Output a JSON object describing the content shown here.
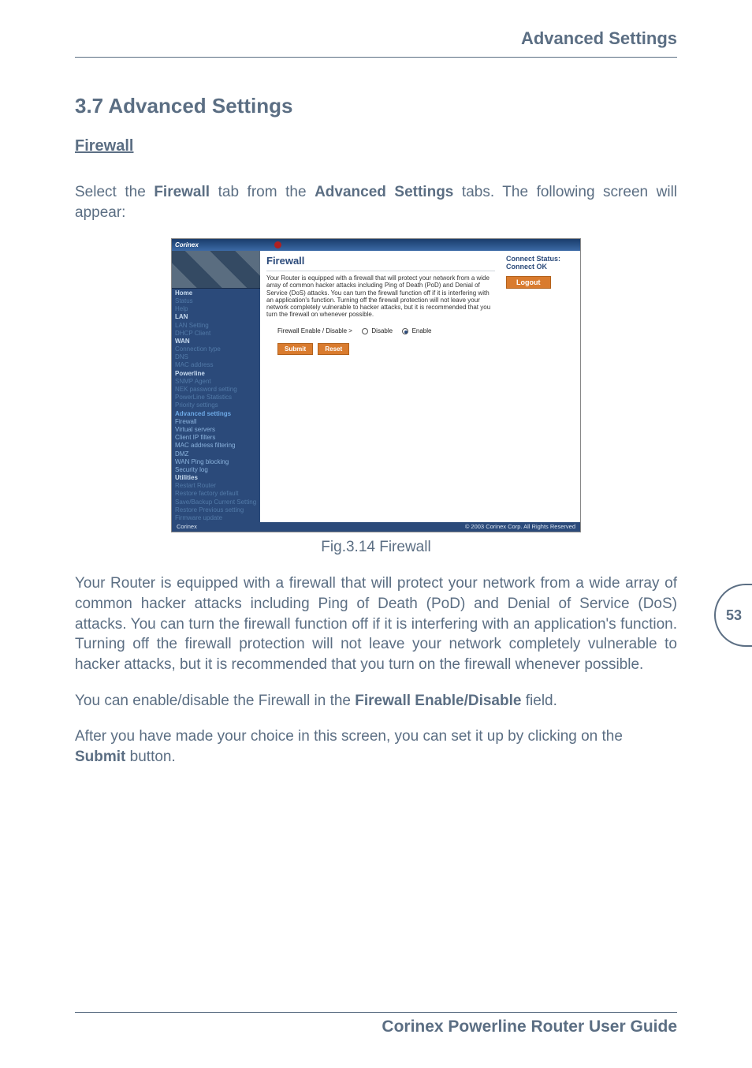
{
  "running_header": "Advanced Settings",
  "page_number": "53",
  "footer": "Corinex Powerline Router User Guide",
  "section_heading": "3.7 Advanced Settings",
  "sub_heading": "Firewall",
  "intro_para": {
    "pre": "Select the ",
    "b1": "Firewall",
    "mid": " tab from the ",
    "b2": "Advanced Settings",
    "post": " tabs. The following screen will appear:"
  },
  "figure_caption": "Fig.3.14 Firewall",
  "body_para_1": "Your Router is equipped with a firewall that will protect your network from a wide array of common hacker attacks including Ping of Death (PoD) and Denial of Service (DoS) attacks. You can turn the firewall function off if it is interfering with an application's function. Turning off the firewall protection will not leave your network completely vulnerable to hacker attacks, but it is recommended that you turn on the firewall whenever possible.",
  "body_para_2": {
    "pre": "You can enable/disable the Firewall in the ",
    "b1": "Firewall Enable/Disable",
    "post": " field."
  },
  "body_para_3": {
    "pre": "After you have made your choice in this screen, you can set it up by clicking on the ",
    "b1": "Submit",
    "post": " button."
  },
  "screenshot": {
    "brand": "Corinex",
    "panel_title": "Firewall",
    "description": "Your Router is equipped with a firewall that will protect your network from a wide array of common hacker attacks including Ping of Death (PoD) and Denial of Service (DoS) attacks. You can turn the firewall function off if it is interfering with an application's function. Turning off the firewall protection will not leave your network completely vulnerable to hacker attacks, but it is recommended that you turn the firewall on whenever possible.",
    "toggle_label": "Firewall Enable / Disable >",
    "radio_disable": "Disable",
    "radio_enable": "Enable",
    "btn_submit": "Submit",
    "btn_reset": "Reset",
    "status_label": "Connect Status:",
    "status_value": "Connect OK",
    "logout": "Logout",
    "footer_left": "Corinex",
    "footer_right": "© 2003 Corinex Corp. All Rights Reserved",
    "nav": [
      {
        "label": "Home",
        "cls": "top"
      },
      {
        "label": "Status",
        "cls": "dim"
      },
      {
        "label": "Help",
        "cls": "dim"
      },
      {
        "label": "LAN",
        "cls": "top"
      },
      {
        "label": "LAN Setting",
        "cls": "dim"
      },
      {
        "label": "DHCP Client",
        "cls": "dim"
      },
      {
        "label": "WAN",
        "cls": "top"
      },
      {
        "label": "Connection type",
        "cls": "dim"
      },
      {
        "label": "DNS",
        "cls": "dim"
      },
      {
        "label": "MAC address",
        "cls": "dim"
      },
      {
        "label": "Powerline",
        "cls": "top"
      },
      {
        "label": "SNMP Agent",
        "cls": "dim"
      },
      {
        "label": "NEK password setting",
        "cls": "dim"
      },
      {
        "label": "PowerLine Statistics",
        "cls": "dim"
      },
      {
        "label": "Priority settings",
        "cls": "dim"
      },
      {
        "label": "Advanced settings",
        "cls": "sel"
      },
      {
        "label": "Firewall",
        "cls": "mid"
      },
      {
        "label": "Virtual servers",
        "cls": "mid"
      },
      {
        "label": "Client IP filters",
        "cls": "mid"
      },
      {
        "label": "MAC address filtering",
        "cls": "mid"
      },
      {
        "label": "DMZ",
        "cls": "mid"
      },
      {
        "label": "WAN Ping blocking",
        "cls": "mid"
      },
      {
        "label": "Security log",
        "cls": "mid"
      },
      {
        "label": "Utilities",
        "cls": "top"
      },
      {
        "label": "Restart Router",
        "cls": "dim"
      },
      {
        "label": "Restore factory default",
        "cls": "dim"
      },
      {
        "label": "Save/Backup Current Setting",
        "cls": "dim"
      },
      {
        "label": "Restore Previous setting",
        "cls": "dim"
      },
      {
        "label": "Firmware update",
        "cls": "dim"
      }
    ]
  }
}
